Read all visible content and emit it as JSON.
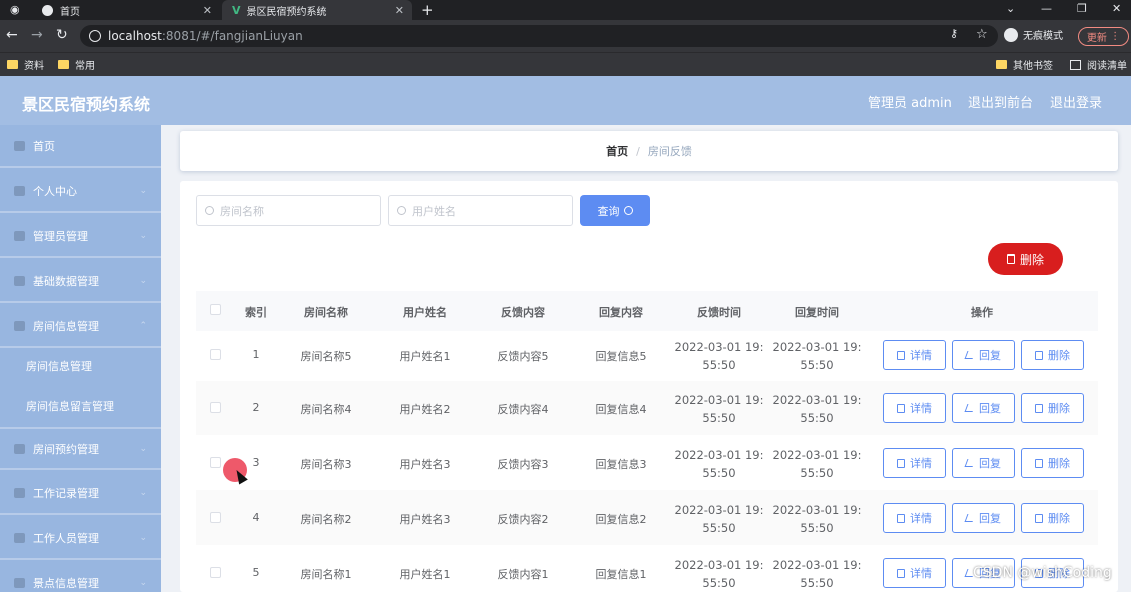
{
  "browser": {
    "tabs": [
      {
        "title": "首页"
      },
      {
        "title": "景区民宿预约系统"
      }
    ],
    "url_host": "localhost",
    "url_rest": ":8081/#/fangjianLiuyan",
    "incognito_label": "无痕模式",
    "update_label": "更新",
    "bookmarks": [
      "资料",
      "常用"
    ],
    "bookmarks_right": [
      "其他书签",
      "阅读清单"
    ]
  },
  "header": {
    "title": "景区民宿预约系统",
    "admin_label": "管理员 admin",
    "to_front_label": "退出到前台",
    "logout_label": "退出登录"
  },
  "sidebar": {
    "items": [
      {
        "label": "首页",
        "icon": "home-icon"
      },
      {
        "label": "个人中心",
        "icon": "user-icon"
      },
      {
        "label": "管理员管理",
        "icon": "admin-icon"
      },
      {
        "label": "基础数据管理",
        "icon": "data-icon"
      },
      {
        "label": "房间信息管理",
        "icon": "room-icon"
      },
      {
        "label": "房间信息管理",
        "icon": ""
      },
      {
        "label": "房间信息留言管理",
        "icon": ""
      },
      {
        "label": "房间预约管理",
        "icon": "booking-icon"
      },
      {
        "label": "工作记录管理",
        "icon": "record-icon"
      },
      {
        "label": "工作人员管理",
        "icon": "staff-icon"
      },
      {
        "label": "景点信息管理",
        "icon": "scenic-icon"
      }
    ]
  },
  "breadcrumb": {
    "home": "首页",
    "separator": "/",
    "current": "房间反馈"
  },
  "search": {
    "room_placeholder": "房间名称",
    "user_placeholder": "用户姓名",
    "query_label": "查询"
  },
  "toolbar": {
    "delete_label": "删除"
  },
  "table": {
    "headers": [
      "索引",
      "房间名称",
      "用户姓名",
      "反馈内容",
      "回复内容",
      "反馈时间",
      "回复时间",
      "操作"
    ],
    "rows": [
      {
        "index": "1",
        "room": "房间名称5",
        "user": "用户姓名1",
        "feedback": "反馈内容5",
        "reply": "回复信息5",
        "fb_time_1": "2022-03-01 19:",
        "fb_time_2": "55:50",
        "rp_time_1": "2022-03-01 19:",
        "rp_time_2": "55:50"
      },
      {
        "index": "2",
        "room": "房间名称4",
        "user": "用户姓名2",
        "feedback": "反馈内容4",
        "reply": "回复信息4",
        "fb_time_1": "2022-03-01 19:",
        "fb_time_2": "55:50",
        "rp_time_1": "2022-03-01 19:",
        "rp_time_2": "55:50"
      },
      {
        "index": "3",
        "room": "房间名称3",
        "user": "用户姓名3",
        "feedback": "反馈内容3",
        "reply": "回复信息3",
        "fb_time_1": "2022-03-01 19:",
        "fb_time_2": "55:50",
        "rp_time_1": "2022-03-01 19:",
        "rp_time_2": "55:50"
      },
      {
        "index": "4",
        "room": "房间名称2",
        "user": "用户姓名3",
        "feedback": "反馈内容2",
        "reply": "回复信息2",
        "fb_time_1": "2022-03-01 19:",
        "fb_time_2": "55:50",
        "rp_time_1": "2022-03-01 19:",
        "rp_time_2": "55:50"
      },
      {
        "index": "5",
        "room": "房间名称1",
        "user": "用户姓名1",
        "feedback": "反馈内容1",
        "reply": "回复信息1",
        "fb_time_1": "2022-03-01 19:",
        "fb_time_2": "55:50",
        "rp_time_1": "2022-03-01 19:",
        "rp_time_2": "55:50"
      }
    ],
    "actions": {
      "detail": "详情",
      "reply": "回复",
      "delete": "删除"
    }
  },
  "watermark": "CSDN @wishCoding",
  "colors": {
    "header_bg": "#a2bde3",
    "sidebar_bg": "#98b6e0",
    "primary": "#5d8cf2",
    "danger": "#d81e1e"
  }
}
